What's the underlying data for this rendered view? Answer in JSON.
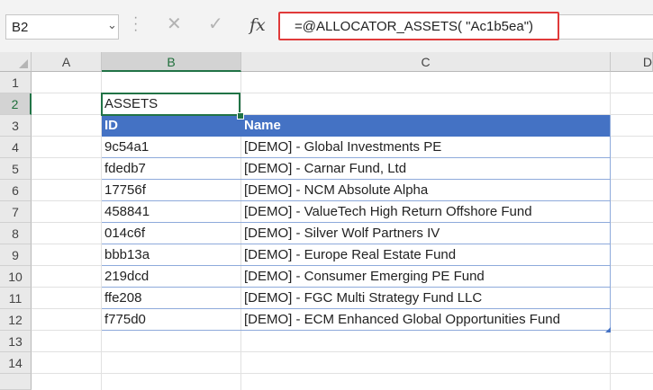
{
  "name_box": {
    "value": "B2"
  },
  "formula_bar": {
    "cancel_glyph": "✕",
    "enter_glyph": "✓",
    "fx_label": "fx",
    "formula": "=@ALLOCATOR_ASSETS( \"Ac1b5ea\")"
  },
  "columns": [
    "A",
    "B",
    "C",
    "D"
  ],
  "rows": [
    "1",
    "2",
    "3",
    "4",
    "5",
    "6",
    "7",
    "8",
    "9",
    "10",
    "11",
    "12",
    "13",
    "14"
  ],
  "selected": {
    "column": "B",
    "row": "2"
  },
  "sheet": {
    "title_cell": "ASSETS",
    "table_headers": {
      "id": "ID",
      "name": "Name"
    },
    "assets": [
      {
        "id": "9c54a1",
        "name": "[DEMO] - Global Investments PE"
      },
      {
        "id": "fdedb7",
        "name": "[DEMO] - Carnar Fund, Ltd"
      },
      {
        "id": "17756f",
        "name": "[DEMO] - NCM Absolute Alpha"
      },
      {
        "id": "458841",
        "name": "[DEMO] - ValueTech High Return Offshore Fund"
      },
      {
        "id": "014c6f",
        "name": "[DEMO] - Silver Wolf Partners IV"
      },
      {
        "id": "bbb13a",
        "name": "[DEMO] - Europe Real Estate Fund"
      },
      {
        "id": "219dcd",
        "name": "[DEMO] - Consumer Emerging PE Fund"
      },
      {
        "id": "ffe208",
        "name": "[DEMO] - FGC Multi Strategy Fund LLC"
      },
      {
        "id": "f775d0",
        "name": "[DEMO] - ECM Enhanced Global Opportunities Fund"
      }
    ]
  },
  "colors": {
    "table_header": "#4472c4",
    "selection": "#217346",
    "highlight_border": "#e03a3a"
  }
}
